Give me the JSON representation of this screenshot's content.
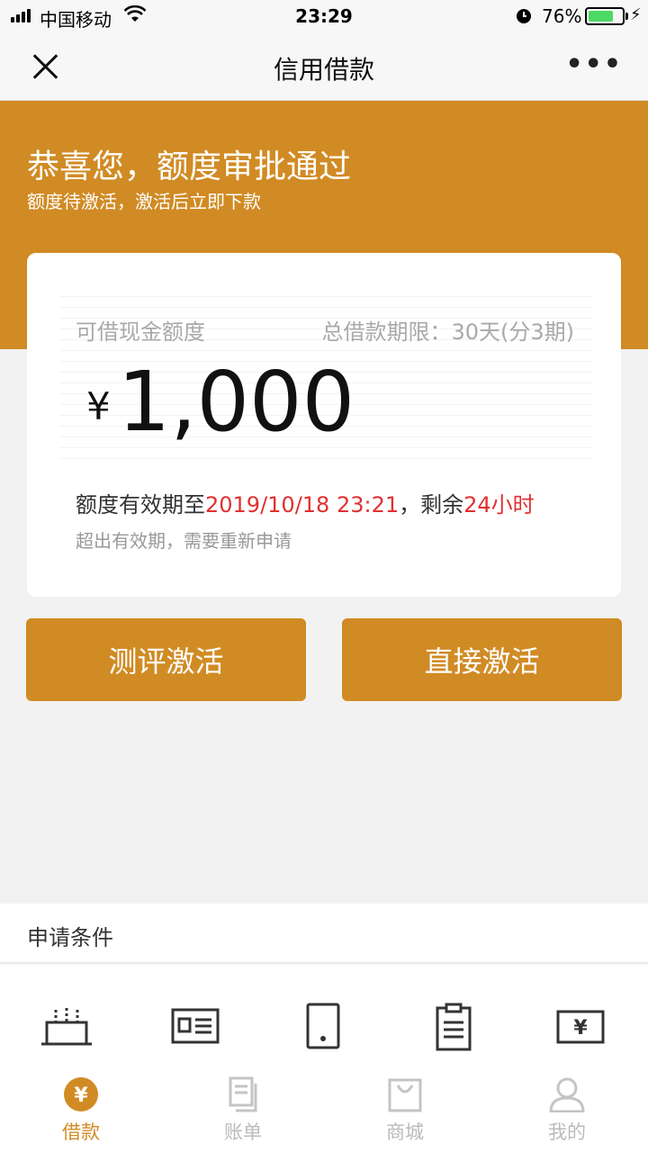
{
  "status_bar": {
    "carrier": "中国移动",
    "time": "23:29",
    "battery_percent": "76%",
    "battery_level": 0.76
  },
  "nav": {
    "title": "信用借款"
  },
  "banner": {
    "headline": "恭喜您，额度审批通过",
    "subline": "额度待激活，激活后立即下款"
  },
  "card": {
    "label_left": "可借现金额度",
    "label_right": "总借款期限：30天(分3期)",
    "currency": "¥",
    "amount": "1,000",
    "valid_prefix": "额度有效期至",
    "valid_date": "2019/10/18 23:21",
    "valid_mid": "，剩余",
    "valid_remaining": "24小时",
    "note": "超出有效期，需要重新申请"
  },
  "buttons": {
    "left": "测评激活",
    "right": "直接激活"
  },
  "conditions": {
    "title": "申请条件",
    "icons": [
      "cake-icon",
      "id-card-icon",
      "phone-icon",
      "clipboard-icon",
      "bank-card-icon"
    ]
  },
  "tabs": [
    {
      "label": "借款",
      "icon": "yen-circle-icon",
      "active": true
    },
    {
      "label": "账单",
      "icon": "bill-icon",
      "active": false
    },
    {
      "label": "商城",
      "icon": "bag-icon",
      "active": false
    },
    {
      "label": "我的",
      "icon": "user-icon",
      "active": false
    }
  ],
  "colors": {
    "accent": "#d18b24",
    "highlight_red": "#e03030",
    "tab_inactive": "#bbbbbb"
  }
}
